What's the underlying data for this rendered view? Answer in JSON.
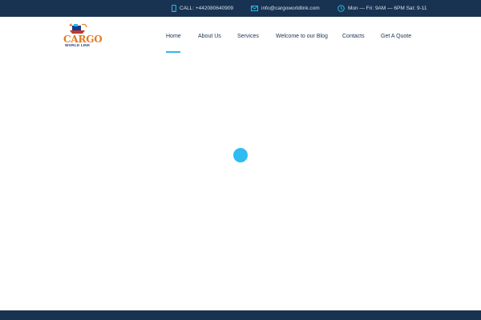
{
  "topbar": {
    "phone": "CALL: +442080640909",
    "email": "info@cargoworldlink.com",
    "hours": "Mon — Fri: 9AM — 6PM Sat: 9-11",
    "colors": {
      "background": "#183251",
      "icon": "#2bbbe8"
    },
    "icons": [
      "phone-icon",
      "mail-icon",
      "clock-icon"
    ]
  },
  "logo": {
    "line1": "CARGO",
    "line2": "WORLD LINK"
  },
  "nav": {
    "items": [
      {
        "label": "Home",
        "active": true
      },
      {
        "label": "About Us"
      },
      {
        "label": "Services"
      },
      {
        "label": "Welcome to our Blog"
      },
      {
        "label": "Contacts"
      },
      {
        "label": "Get A Quote"
      }
    ],
    "active_color": "#2bbbe8"
  },
  "loader": {
    "color": "#2ebcf2"
  },
  "footer": {
    "color": "#183251"
  }
}
